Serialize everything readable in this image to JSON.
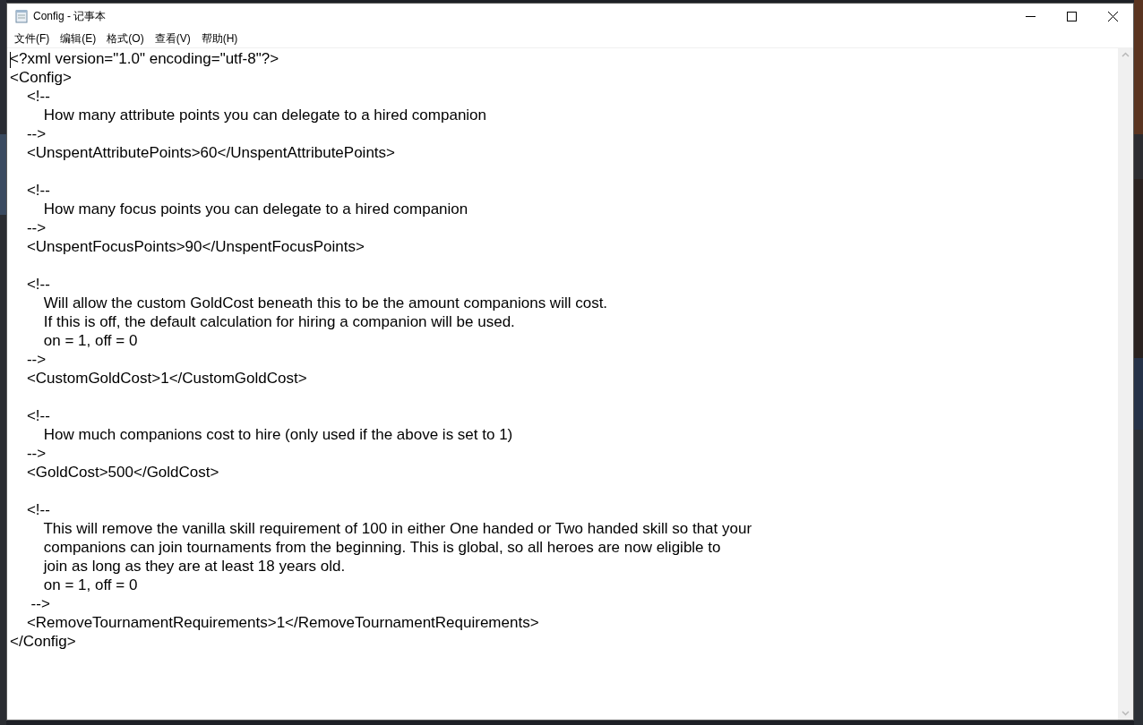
{
  "window": {
    "title": "Config - 记事本"
  },
  "menu": [
    {
      "label": "文件(F)"
    },
    {
      "label": "编辑(E)"
    },
    {
      "label": "格式(O)"
    },
    {
      "label": "查看(V)"
    },
    {
      "label": "帮助(H)"
    }
  ],
  "document": {
    "content": "<?xml version=\"1.0\" encoding=\"utf-8\"?>\n<Config>\n    <!--\n        How many attribute points you can delegate to a hired companion\n    -->\n    <UnspentAttributePoints>60</UnspentAttributePoints>\n\n    <!--\n        How many focus points you can delegate to a hired companion\n    -->\n    <UnspentFocusPoints>90</UnspentFocusPoints>\n\n    <!--\n        Will allow the custom GoldCost beneath this to be the amount companions will cost.\n        If this is off, the default calculation for hiring a companion will be used.\n        on = 1, off = 0\n    -->\n    <CustomGoldCost>1</CustomGoldCost>\n\n    <!--\n        How much companions cost to hire (only used if the above is set to 1)\n    -->\n    <GoldCost>500</GoldCost>\n\n    <!--\n        This will remove the vanilla skill requirement of 100 in either One handed or Two handed skill so that your\n        companions can join tournaments from the beginning. This is global, so all heroes are now eligible to\n        join as long as they are at least 18 years old.\n        on = 1, off = 0\n     -->\n    <RemoveTournamentRequirements>1</RemoveTournamentRequirements>\n</Config>"
  }
}
